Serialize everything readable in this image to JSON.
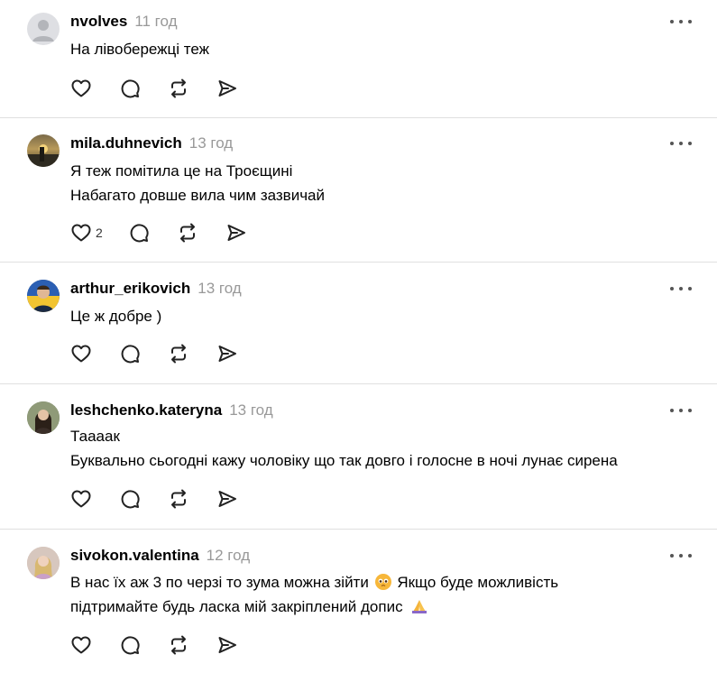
{
  "posts": [
    {
      "username": "nvolves",
      "time": "11 год",
      "lines": [
        "На лівобережці теж"
      ],
      "likes": "",
      "avatar": "default-avatar"
    },
    {
      "username": "mila.duhnevich",
      "time": "13 год",
      "lines": [
        "Я теж помітила це на Троєщині",
        "Набагато довше вила чим зазвичай"
      ],
      "likes": "2",
      "avatar": "photo-sunset"
    },
    {
      "username": "arthur_erikovich",
      "time": "13 год",
      "lines": [
        "Це ж добре )"
      ],
      "likes": "",
      "avatar": "photo-flag"
    },
    {
      "username": "leshchenko.kateryna",
      "time": "13 год",
      "lines": [
        "Тааaак",
        "Буквально сьогодні кажу чоловіку що так довго і голосне в ночі лунає сирена"
      ],
      "likes": "",
      "avatar": "photo-portrait"
    },
    {
      "username": "sivokon.valentina",
      "time": "12 год",
      "lines": [
        "В нас їх аж 3 по черзі то зума можна зійти",
        "Якщо буде можливість",
        "підтримайте будь ласка мій закріплений допис"
      ],
      "likes": "",
      "avatar": "photo-portrait-2"
    }
  ],
  "icons": {
    "like": "heart-icon",
    "reply": "comment-icon",
    "repost": "repost-icon",
    "share": "send-icon",
    "more": "more-icon"
  },
  "colors": {
    "text": "#000000",
    "muted": "#999999",
    "divider": "#e0e0e0"
  }
}
